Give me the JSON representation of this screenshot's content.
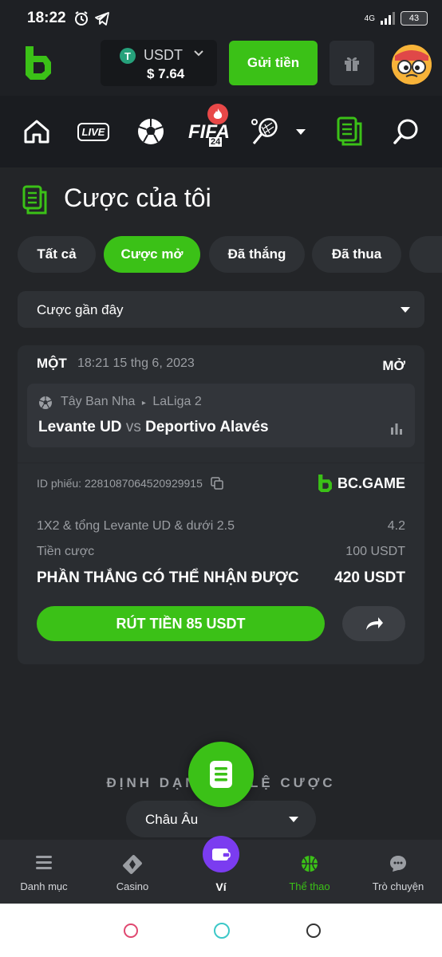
{
  "status_bar": {
    "time": "18:22",
    "network": "4G",
    "battery": "43"
  },
  "header": {
    "currency": "USDT",
    "balance": "$ 7.64",
    "deposit_label": "Gửi tiền"
  },
  "nav": {
    "live_label": "LIVE",
    "fifa_label": "FIFA",
    "fifa_year": "24"
  },
  "page": {
    "title": "Cược của tôi",
    "tabs": [
      {
        "label": "Tất cả",
        "active": false
      },
      {
        "label": "Cược mở",
        "active": true
      },
      {
        "label": "Đã thắng",
        "active": false
      },
      {
        "label": "Đã thua",
        "active": false
      }
    ],
    "filter": {
      "selected": "Cược gần đây"
    }
  },
  "bet": {
    "type": "MỘT",
    "datetime": "18:21 15 thg 6, 2023",
    "status": "MỞ",
    "country": "Tây Ban Nha",
    "league": "LaLiga 2",
    "home": "Levante UD",
    "vs": "vs",
    "away": "Deportivo Alavés",
    "ticket_label": "ID phiếu:",
    "ticket_id": "2281087064520929915",
    "brand": "BC.GAME",
    "market": "1X2 & tổng Levante UD & dưới 2.5",
    "odds": "4.2",
    "stake_label": "Tiền cược",
    "stake": "100 USDT",
    "win_label": "PHẦN THẮNG CÓ THỂ NHẬN ĐƯỢC",
    "win_amount": "420 USDT",
    "cashout_label": "RÚT TIỀN 85 USDT"
  },
  "odds_format": {
    "title": "ĐỊNH DẠNG TỶ LỆ CƯỢC",
    "selected": "Châu Âu"
  },
  "bottom_nav": [
    {
      "label": "Danh mục",
      "active": false
    },
    {
      "label": "Casino",
      "active": false
    },
    {
      "label": "Ví",
      "active": false
    },
    {
      "label": "Thể thao",
      "active": true
    },
    {
      "label": "Trò chuyện",
      "active": false
    }
  ],
  "colors": {
    "accent": "#3bc117",
    "background": "#232528",
    "card": "#2a2d31",
    "wallet": "#7b3cf0"
  }
}
